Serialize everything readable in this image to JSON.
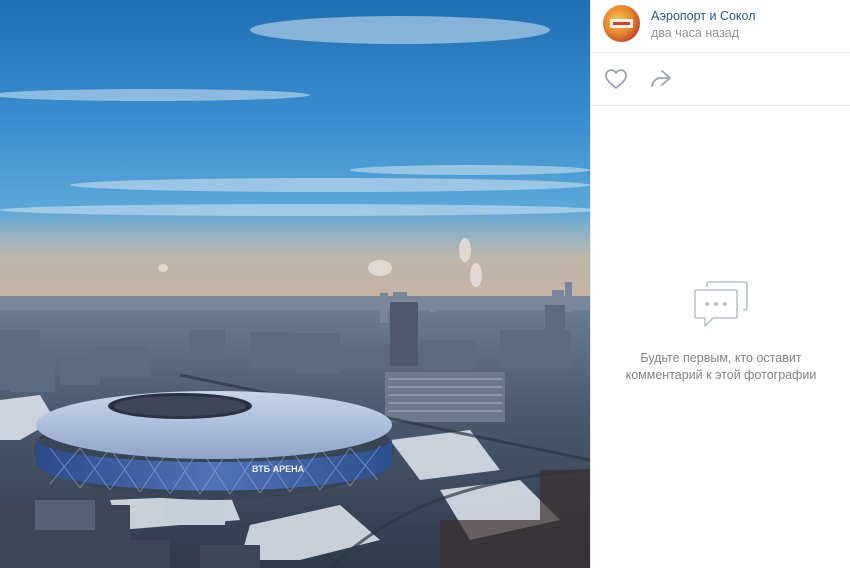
{
  "post": {
    "author": "Аэропорт и Сокол",
    "time": "два часа назад"
  },
  "photo": {
    "stadium_sign": "ВТБ АРЕНА"
  },
  "actions": {
    "like_icon": "heart-icon",
    "share_icon": "share-arrow-icon"
  },
  "comments": {
    "empty_icon": "chat-bubble-icon",
    "empty_text": "Будьте первым, кто оставит комментарий к этой фотографии"
  },
  "colors": {
    "link": "#2a5885",
    "muted": "#939393",
    "icon": "#99a2ad"
  }
}
